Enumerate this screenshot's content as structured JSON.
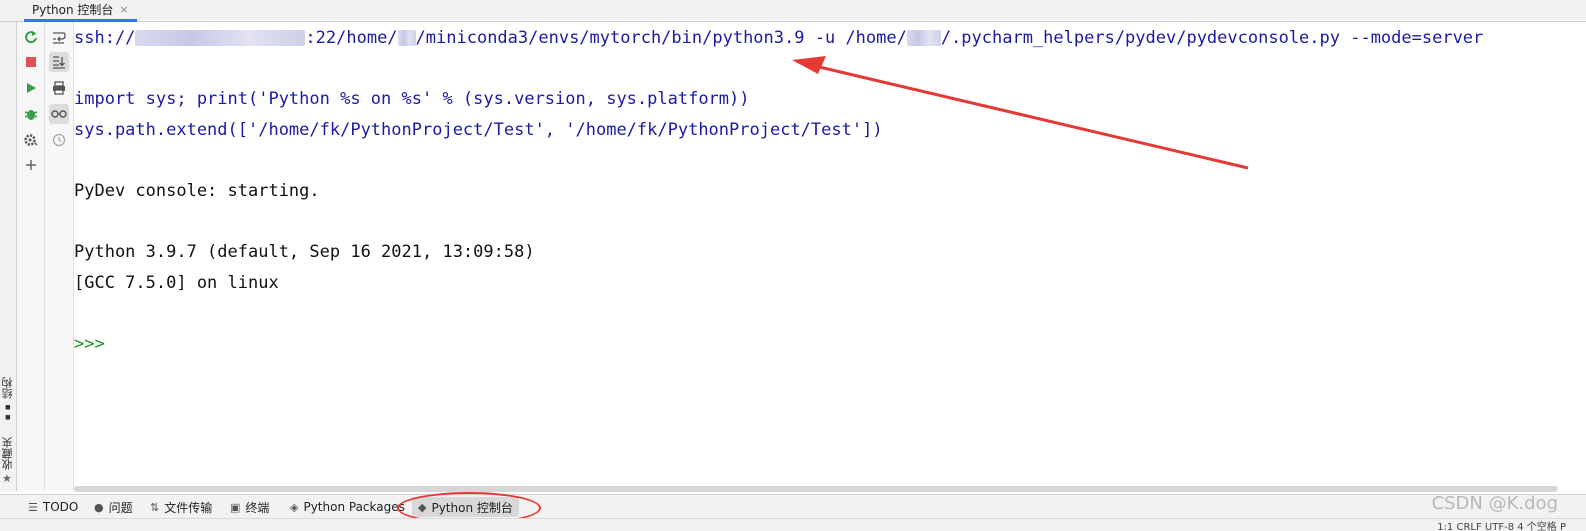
{
  "tab": {
    "title": "Python 控制台",
    "close": "×"
  },
  "side": {
    "structure": "结构",
    "favorites": "收藏夹"
  },
  "console": {
    "cmd_prefix": "ssh://",
    "cmd_port": ":22/home/",
    "cmd_mid": "/miniconda3/envs/mytorch/bin/python3.9 -u /home/",
    "cmd_tail": "/.pycharm_helpers/pydev/pydevconsole.py --mode=server",
    "import_line": "import sys; print('Python %s on %s' % (sys.version, sys.platform))",
    "extend_line": "sys.path.extend(['/home/fk/PythonProject/Test', '/home/fk/PythonProject/Test'])",
    "starting": "PyDev console: starting.",
    "version_line": "Python 3.9.7 (default, Sep 16 2021, 13:09:58)",
    "gcc_line": "[GCC 7.5.0] on linux",
    "prompt": ">>>"
  },
  "bottom_tabs": [
    {
      "label": "TODO",
      "icon": "list-icon"
    },
    {
      "label": "问题",
      "icon": "info-icon"
    },
    {
      "label": "文件传输",
      "icon": "transfer-icon"
    },
    {
      "label": "终端",
      "icon": "terminal-icon"
    },
    {
      "label": "Python Packages",
      "icon": "layers-icon"
    },
    {
      "label": "Python 控制台",
      "icon": "python-icon"
    }
  ],
  "watermark": "CSDN @K.dog",
  "status": "1:1  CRLF  UTF-8  4 个空格  P",
  "colors": {
    "accent": "#3574f0",
    "annotation": "#e53935",
    "code_blue": "#1a1aa6",
    "prompt_green": "#159415"
  }
}
